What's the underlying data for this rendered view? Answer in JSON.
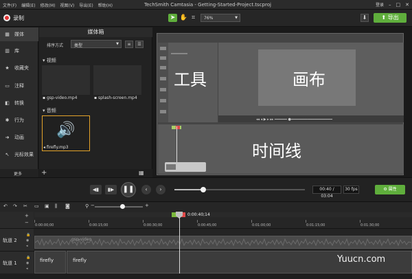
{
  "menu": [
    "文件(F)",
    "编辑(E)",
    "修改(M)",
    "视图(V)",
    "导出(E)",
    "帮助(H)"
  ],
  "window_title": "TechSmith Camtasia - Getting-Started-Project.tscproj",
  "login_label": "登录",
  "toolbar": {
    "record_label": "录制",
    "zoom_value": "76%",
    "export_label": "导出"
  },
  "sidebar": {
    "items": [
      {
        "label": "媒体",
        "icon": "film-icon"
      },
      {
        "label": "库",
        "icon": "library-icon"
      },
      {
        "label": "收藏夹",
        "icon": "star-icon"
      },
      {
        "label": "注释",
        "icon": "annotation-icon"
      },
      {
        "label": "转换",
        "icon": "transition-icon"
      },
      {
        "label": "行为",
        "icon": "behavior-icon"
      },
      {
        "label": "动画",
        "icon": "animation-icon"
      },
      {
        "label": "光标效果",
        "icon": "cursor-icon"
      }
    ],
    "more_label": "更多"
  },
  "media_bin": {
    "title": "媒体箱",
    "sort_label": "排序方式",
    "sort_value": "类型",
    "video_section": "视频",
    "audio_section": "音频",
    "videos": [
      "gsp-video.mp4",
      "splash-screen.mp4"
    ],
    "audio": [
      "firefly.mp3"
    ]
  },
  "canvas": {
    "label_tools": "工具",
    "label_canvas": "画布",
    "label_timeline": "时间线"
  },
  "playback": {
    "time": "00:40 / 03:04",
    "fps": "30 fps",
    "properties_label": "属性",
    "progress": 0.22
  },
  "ruler": {
    "playhead_time": "0:00:40;14",
    "ticks": [
      "0:00:00;00",
      "0:00:15;00",
      "0:00:30;00",
      "0:00:45;00",
      "0:01:00;00",
      "0:01:15;00",
      "0:01:30;00"
    ]
  },
  "tracks": [
    {
      "label": "轨道 2",
      "clips": [
        {
          "label": "gsp-video"
        }
      ]
    },
    {
      "label": "轨道 1",
      "clips": [
        {
          "label": "firefly"
        },
        {
          "label": "firefly"
        }
      ]
    }
  ],
  "watermark": "Yuucn.com",
  "colors": {
    "accent": "#5fae3c",
    "record": "#e23434",
    "selected_border": "#e4a32a"
  }
}
